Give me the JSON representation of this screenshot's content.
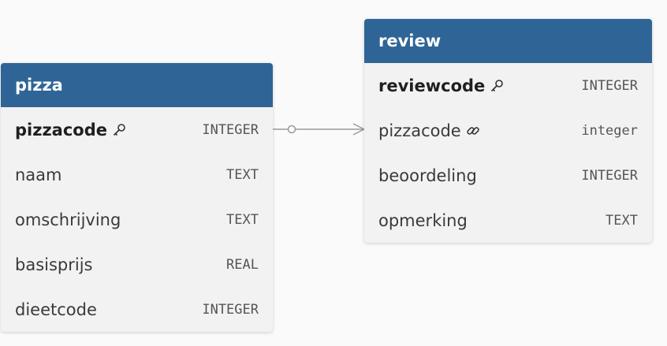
{
  "colors": {
    "header": "#2f6596",
    "table_bg": "#f2f2f2",
    "canvas_bg": "#fafafa",
    "connector": "#9a9a9a"
  },
  "tables": [
    {
      "name": "pizza",
      "columns": [
        {
          "name": "pizzacode",
          "type": "INTEGER",
          "key": "primary",
          "icon": "key-icon"
        },
        {
          "name": "naam",
          "type": "TEXT"
        },
        {
          "name": "omschrijving",
          "type": "TEXT"
        },
        {
          "name": "basisprijs",
          "type": "REAL"
        },
        {
          "name": "dieetcode",
          "type": "INTEGER"
        }
      ]
    },
    {
      "name": "review",
      "columns": [
        {
          "name": "reviewcode",
          "type": "INTEGER",
          "key": "primary",
          "icon": "key-icon"
        },
        {
          "name": "pizzacode",
          "type": "integer",
          "key": "foreign",
          "icon": "link-icon"
        },
        {
          "name": "beoordeling",
          "type": "INTEGER"
        },
        {
          "name": "opmerking",
          "type": "TEXT"
        }
      ]
    }
  ],
  "relations": [
    {
      "from": "pizza.pizzacode",
      "to": "review.pizzacode",
      "from_end": "zero-or-one",
      "to_end": "many"
    }
  ]
}
